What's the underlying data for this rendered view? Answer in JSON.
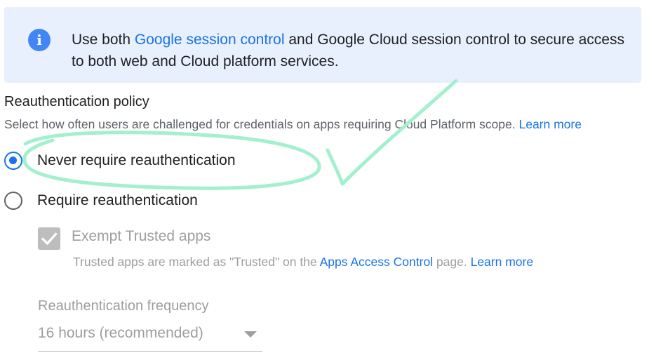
{
  "banner": {
    "text_before": "Use both ",
    "link_text": "Google session control",
    "text_after": " and Google Cloud session control to secure access to both web and Cloud platform services.",
    "icon": "info-icon"
  },
  "policy": {
    "title": "Reauthentication policy",
    "description": "Select how often users are challenged for credentials on apps requiring Cloud Platform scope. ",
    "learn_more": "Learn more",
    "options": [
      {
        "label": "Never require reauthentication",
        "selected": true
      },
      {
        "label": "Require reauthentication",
        "selected": false
      }
    ]
  },
  "exempt": {
    "label": "Exempt Trusted apps",
    "checked": true,
    "note_before": "Trusted apps are marked as \"Trusted\" on the ",
    "note_link": "Apps Access Control",
    "note_after": " page. ",
    "learn_more": "Learn more"
  },
  "frequency": {
    "label": "Reauthentication frequency",
    "value": "16 hours (recommended)"
  },
  "colors": {
    "banner_bg": "#e8f0fe",
    "link": "#1a73e8",
    "annotation": "#a3f0cf"
  }
}
